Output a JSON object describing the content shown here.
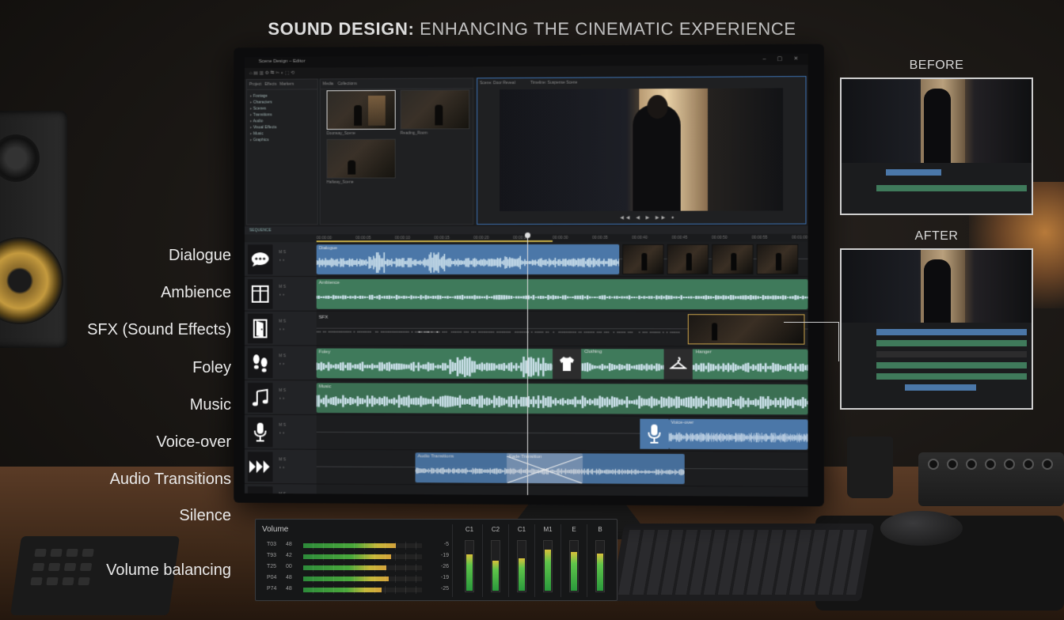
{
  "title": {
    "bold": "SOUND DESIGN:",
    "rest": "ENHANCING THE CINEMATIC EXPERIENCE"
  },
  "window": {
    "title": "Scene Design – Editor",
    "controls": "–  ▢  ✕"
  },
  "project_panel": {
    "tabs": [
      "Project",
      "Effects",
      "Markers"
    ],
    "items": [
      "Footage",
      "Characters",
      "Scenes",
      "Transitions",
      "Audio",
      "Visual Effects",
      "Music",
      "Graphics"
    ]
  },
  "media_panel": {
    "tabs": [
      "Media",
      "Collections"
    ],
    "thumbs": [
      "Doorway_Scene",
      "Reading_Room",
      "Hallway_Scene"
    ]
  },
  "program_monitor": {
    "tab": "Scene: Door Reveal",
    "header": "Timeline: Suspense Scene",
    "transport": "◀◀ ◀ ▶ ▶▶ ●"
  },
  "timeline": {
    "header": "SEQUENCE",
    "ruler": [
      "00:00:00",
      "00:00:05",
      "00:00:10",
      "00:00:15",
      "00:00:20",
      "00:00:25",
      "00:00:30",
      "00:00:35",
      "00:00:40",
      "00:00:45",
      "00:00:50",
      "00:00:55",
      "00:01:00"
    ],
    "tracks": [
      {
        "label": "Dialogue",
        "clip_label": "Dialogue",
        "icon": "speech-bubble-icon"
      },
      {
        "label": "Ambience",
        "clip_label": "Ambience",
        "icon": "window-icon"
      },
      {
        "label": "SFX (Sound Effects)",
        "clip_label": "SFX",
        "icon": "door-icon"
      },
      {
        "label": "Foley",
        "clip_label": "Foley",
        "icon": "footsteps-icon"
      },
      {
        "label": "Music",
        "clip_label": "Music",
        "icon": "music-note-icon"
      },
      {
        "label": "Voice-over",
        "clip_label": "Voice-over",
        "icon": "microphone-icon"
      },
      {
        "label": "Audio Transitions",
        "clip_label": "Audio Transitions",
        "icon": "fast-forward-icon"
      },
      {
        "label": "Silence",
        "clip_label": "",
        "icon": "silence-meter-icon"
      }
    ],
    "foley_tags": [
      "Clothing",
      "Hanger"
    ],
    "fade_label": "Fade Transition"
  },
  "volume": {
    "title": "Volume",
    "rows": [
      {
        "name": "T03",
        "ch": "48",
        "level": 0.78,
        "db": "-5"
      },
      {
        "name": "T93",
        "ch": "42",
        "level": 0.74,
        "db": "-19"
      },
      {
        "name": "T25",
        "ch": "00",
        "level": 0.7,
        "db": "-26"
      },
      {
        "name": "P04",
        "ch": "48",
        "level": 0.72,
        "db": "-19"
      },
      {
        "name": "P74",
        "ch": "48",
        "level": 0.66,
        "db": "-25"
      }
    ],
    "channels": [
      {
        "name": "C1",
        "level": 0.72
      },
      {
        "name": "C2",
        "level": 0.6
      },
      {
        "name": "C1",
        "level": 0.64
      },
      {
        "name": "M1",
        "level": 0.82
      },
      {
        "name": "E",
        "level": 0.76
      },
      {
        "name": "B",
        "level": 0.74
      }
    ]
  },
  "callouts": {
    "volume_balancing": "Volume balancing"
  },
  "before_after": {
    "before": "BEFORE",
    "after": "AFTER"
  },
  "colors": {
    "dialogue": "#4b77a8",
    "ambience": "#3f7a5b",
    "accent_border": "#3b6fae"
  }
}
